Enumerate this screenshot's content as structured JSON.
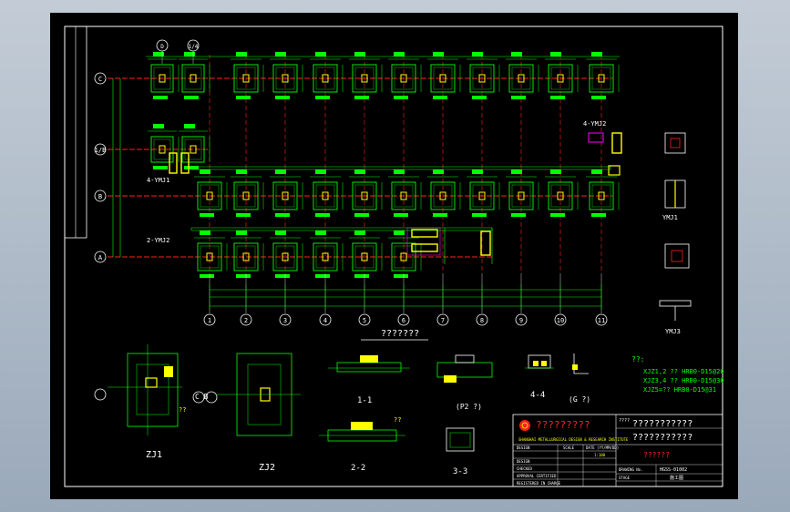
{
  "grid": {
    "rows": [
      "C",
      "1/B",
      "B",
      "A"
    ],
    "cols": [
      "1",
      "2",
      "3",
      "4",
      "5",
      "6",
      "7",
      "8",
      "9",
      "10",
      "11"
    ],
    "top_bubbles": [
      "D",
      "1/4"
    ]
  },
  "plan_title": "???????",
  "labels": {
    "zj1": "ZJ1",
    "zj2": "ZJ2",
    "s11": "1-1",
    "s22": "2-2",
    "s33": "3-3",
    "s44": "4-4",
    "s_g": "(G ?)",
    "s_p": "(P2 ?)",
    "cross_cb": "C B",
    "qq": "??",
    "ymj1": "YMJ1",
    "ymj2": "YMJ2",
    "ymj3": "YMJ3",
    "lmj1": "4-YMJ1",
    "lmj2": "2-YMJ2",
    "lmj3": "4-YMJ2"
  },
  "notes": {
    "head": "??:",
    "l1": "XJZ1,2 ?? HRB0-D15@20",
    "l2": "XJZ3,4 ?? HRB0-D15@30",
    "l3": "XJZ5=?? HRB0-D15@31"
  },
  "title_block": {
    "company": "?????????",
    "company_en": "SHANGHAI METALLURGICAL DESIGN & RESEARCH INSTITUTE",
    "project_label": "????",
    "project": "???????????",
    "drawing": "???????????",
    "drawing_sub": "??????",
    "row1": [
      "DESIGN",
      "",
      "SCALE",
      "DATE (YY/MM/DD)"
    ],
    "row1_val": "1:100",
    "rows_left": [
      "DESIGN",
      "CHECKED",
      "APPROVAL CERTIFIED",
      "REGISTERED IN CHARGE"
    ],
    "drawing_no_label": "DRAWING No.",
    "drawing_no": "HGSS-01002",
    "stage_label": "STAGE",
    "stage": "施工图"
  },
  "colors": {
    "green": "#00ff00",
    "red": "#ff2020",
    "yellow": "#ffff00",
    "white": "#ffffff",
    "cyan": "#00ffff",
    "magenta": "#ff00ff"
  }
}
